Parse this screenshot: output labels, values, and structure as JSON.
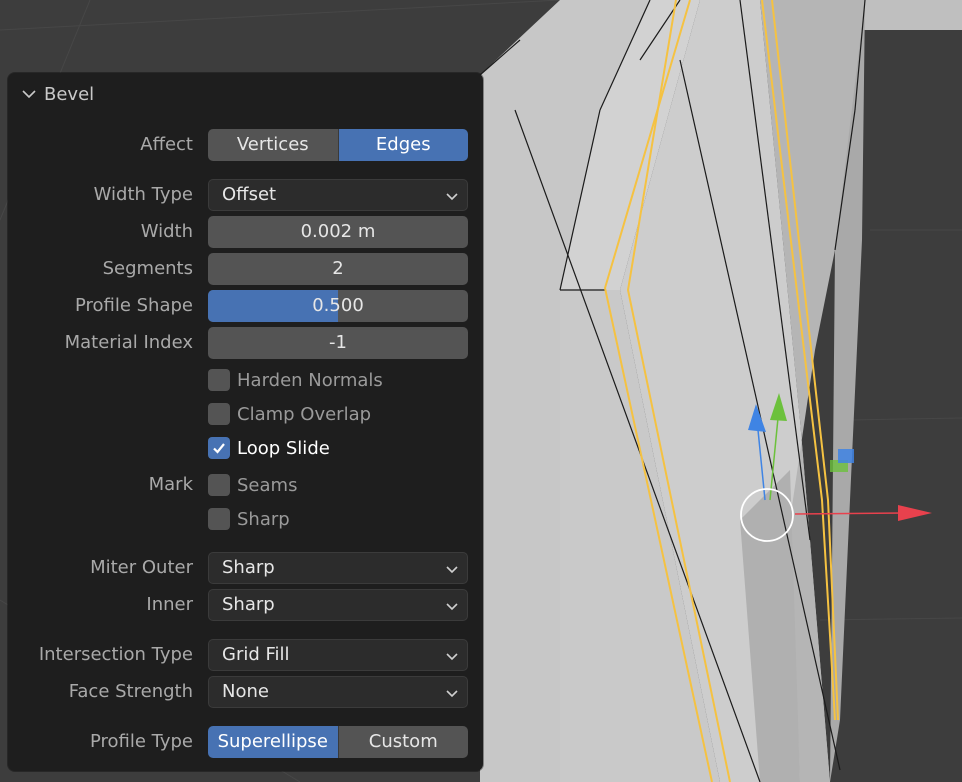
{
  "panel": {
    "title": "Bevel",
    "affect": {
      "label": "Affect",
      "options": [
        "Vertices",
        "Edges"
      ],
      "selected": "Edges"
    },
    "width_type": {
      "label": "Width Type",
      "value": "Offset"
    },
    "width": {
      "label": "Width",
      "value": "0.002 m"
    },
    "segments": {
      "label": "Segments",
      "value": "2"
    },
    "profile_shape": {
      "label": "Profile Shape",
      "value": "0.500",
      "fill_fraction": 0.5
    },
    "material_index": {
      "label": "Material Index",
      "value": "-1"
    },
    "harden_normals": {
      "label": "Harden Normals",
      "checked": false
    },
    "clamp_overlap": {
      "label": "Clamp Overlap",
      "checked": false
    },
    "loop_slide": {
      "label": "Loop Slide",
      "checked": true
    },
    "mark": {
      "label": "Mark",
      "seams": {
        "label": "Seams",
        "checked": false
      },
      "sharp": {
        "label": "Sharp",
        "checked": false
      }
    },
    "miter_outer": {
      "label": "Miter Outer",
      "value": "Sharp"
    },
    "miter_inner": {
      "label": "Inner",
      "value": "Sharp"
    },
    "intersection_type": {
      "label": "Intersection Type",
      "value": "Grid Fill"
    },
    "face_strength": {
      "label": "Face Strength",
      "value": "None"
    },
    "profile_type": {
      "label": "Profile Type",
      "options": [
        "Superellipse",
        "Custom"
      ],
      "selected": "Superellipse"
    }
  },
  "colors": {
    "accent": "#4772b3",
    "panel_bg": "#1e1e1e",
    "selection_edge": "#f5c242",
    "gizmo_x": "#e8414d",
    "gizmo_y": "#6cc13c",
    "gizmo_z": "#3f84e4"
  }
}
